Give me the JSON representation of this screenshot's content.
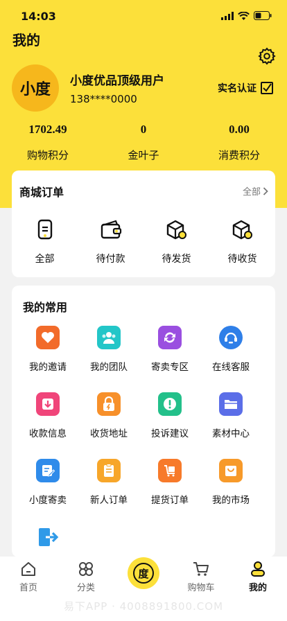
{
  "status_bar": {
    "time": "14:03"
  },
  "header": {
    "title": "我的",
    "avatar_text": "小度",
    "user_name": "小度优品顶级用户",
    "phone": "138****0000",
    "verify_label": "实名认证"
  },
  "stats": [
    {
      "value": "1702.49",
      "label": "购物积分"
    },
    {
      "value": "0",
      "label": "金叶子"
    },
    {
      "value": "0.00",
      "label": "消费积分"
    }
  ],
  "orders": {
    "title": "商城订单",
    "all_label": "全部",
    "items": [
      {
        "label": "全部",
        "icon": "clipboard-icon"
      },
      {
        "label": "待付款",
        "icon": "wallet-icon"
      },
      {
        "label": "待发货",
        "icon": "box-icon"
      },
      {
        "label": "待收货",
        "icon": "box-check-icon"
      }
    ]
  },
  "common": {
    "title": "我的常用",
    "items": [
      {
        "label": "我的邀请",
        "icon": "heart-icon",
        "color": "#f26b2a"
      },
      {
        "label": "我的团队",
        "icon": "team-icon",
        "color": "#23c6c8"
      },
      {
        "label": "寄卖专区",
        "icon": "refresh-icon",
        "color": "#9a4fe0"
      },
      {
        "label": "在线客服",
        "icon": "headset-icon",
        "color": "#2f7fe8"
      },
      {
        "label": "收款信息",
        "icon": "download-icon",
        "color": "#f0457a"
      },
      {
        "label": "收货地址",
        "icon": "lock-icon",
        "color": "#f7902a"
      },
      {
        "label": "投诉建议",
        "icon": "alert-icon",
        "color": "#23c08a"
      },
      {
        "label": "素材中心",
        "icon": "folder-icon",
        "color": "#5b6ee8"
      },
      {
        "label": "小度寄卖",
        "icon": "edit-icon",
        "color": "#2f8bea"
      },
      {
        "label": "新人订单",
        "icon": "clipboard-list-icon",
        "color": "#f7a62a"
      },
      {
        "label": "提货订单",
        "icon": "cart-tag-icon",
        "color": "#f77a2a"
      },
      {
        "label": "我的市场",
        "icon": "bag-icon",
        "color": "#f79a2a"
      },
      {
        "label": "",
        "icon": "logout-icon",
        "color": "#2f9ae8"
      }
    ]
  },
  "tabbar": {
    "items": [
      {
        "label": "首页",
        "icon": "home-icon"
      },
      {
        "label": "分类",
        "icon": "clover-icon"
      },
      {
        "label": "度",
        "icon": "center-logo-icon"
      },
      {
        "label": "购物车",
        "icon": "cart-icon"
      },
      {
        "label": "我的",
        "icon": "user-icon"
      }
    ]
  },
  "watermark": "易下APP · 4008891800.COM"
}
